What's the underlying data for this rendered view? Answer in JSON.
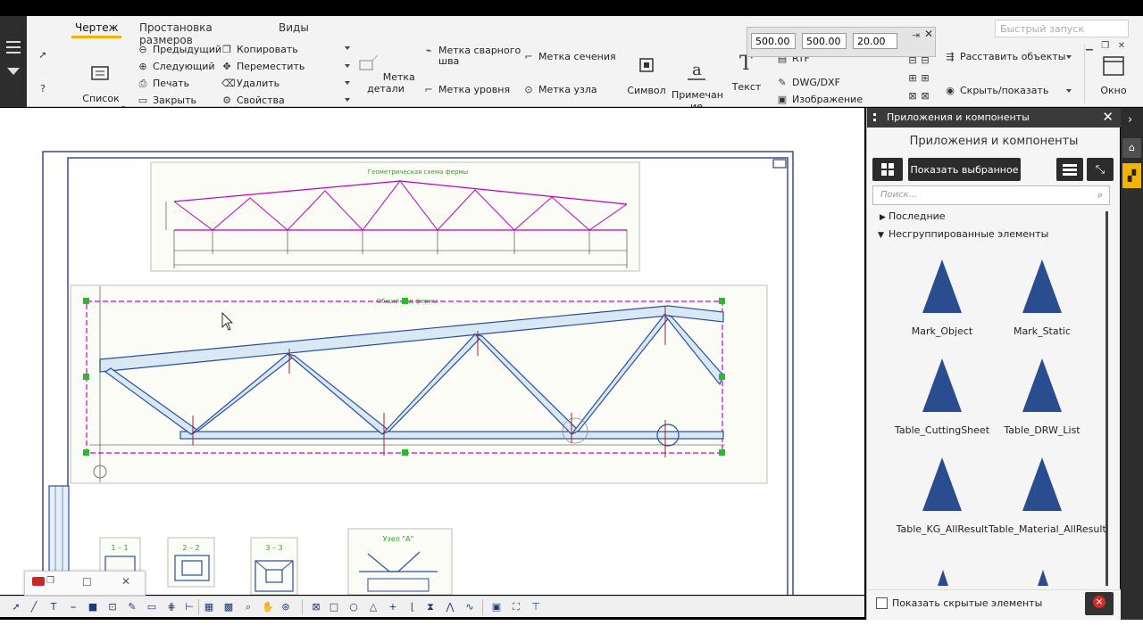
{
  "ribbon": {
    "tabs": [
      "Чертеж",
      "Простановка размеров",
      "Виды"
    ],
    "active_tab": "Чертеж",
    "drawing_list": "Список\nчертежей",
    "nav": {
      "prev": "Предыдущий",
      "next": "Следующий",
      "print": "Печать",
      "close": "Закрыть"
    },
    "edit": {
      "copy": "Копировать",
      "move": "Переместить",
      "delete": "Удалить",
      "props": "Свойства"
    },
    "marks": {
      "detail": "Метка детали",
      "weld": "Метка сварного\nшва",
      "level": "Метка уровня",
      "section": "Метка сечения",
      "node": "Метка узла",
      "symbol": "Символ",
      "note": "Примечан\nие",
      "text": "Текст"
    },
    "insert": {
      "rtf": "RTF",
      "dwg": "DWG/DXF",
      "image": "Изображение"
    },
    "objects": {
      "arrange": "Расставить объекты",
      "hide_show": "Скрыть/показать"
    },
    "window": "Окно",
    "quick_launch_placeholder": "Быстрый запуск",
    "coords": [
      "500.00",
      "500.00",
      "20.00"
    ]
  },
  "drawing": {
    "title1": "Геометрическая схема фермы",
    "title2": "Общий вид фермы",
    "sections": [
      "1 – 1",
      "2 – 2",
      "3 – 3"
    ],
    "node": "Узел \"А\""
  },
  "panel": {
    "header": "Приложения и компоненты",
    "subtitle": "Приложения и компоненты",
    "show_selected": "Показать выбранное",
    "search_placeholder": "Поиск...",
    "tree": {
      "recent": "Последние",
      "ungrouped": "Несгруппированные элементы"
    },
    "components": [
      "Mark_Object",
      "Mark_Static",
      "Table_CuttingSheet",
      "Table_DRW_List",
      "Table_KG_AllResult",
      "Table_Material_AllResult"
    ],
    "show_hidden": "Показать скрытые элементы"
  },
  "colors": {
    "accent": "#f0b400",
    "component_icon": "#2a4d8f",
    "magenta": "#d000d0",
    "truss_blue": "#2a4f9a"
  }
}
